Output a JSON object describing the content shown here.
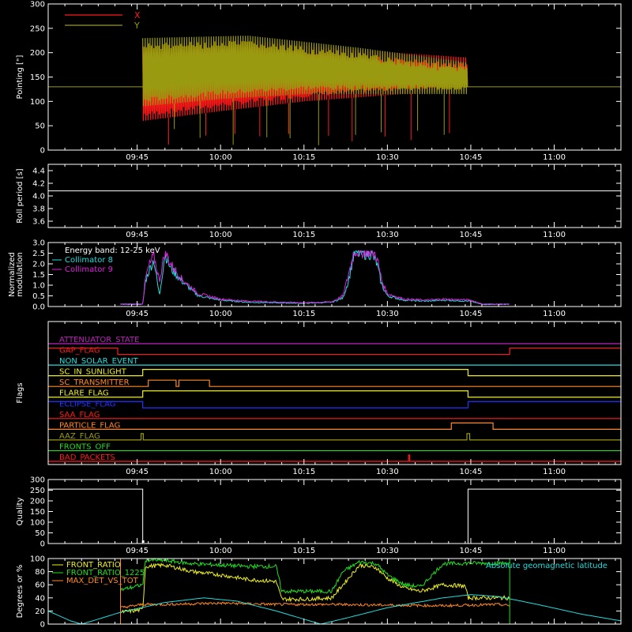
{
  "colors": {
    "background": "#000000",
    "axes": "#ffffff",
    "red": "#ff1a1a",
    "olive": "#9a9a10",
    "cyan": "#22dddd",
    "magenta": "#dd22dd",
    "yellow": "#eeee22",
    "green": "#22dd22",
    "orange": "#ff8822",
    "blue": "#2233ff",
    "purple": "#bb22bb"
  },
  "time_axis": {
    "ticks": [
      "09:45",
      "10:00",
      "10:15",
      "10:30",
      "10:45",
      "11:00"
    ],
    "tick_minutes": [
      585,
      600,
      615,
      630,
      645,
      660
    ],
    "range_minutes": [
      569,
      672
    ]
  },
  "chart_data": [
    {
      "id": "pointing",
      "type": "line",
      "ylabel": "Pointing [\"]",
      "ylim": [
        0,
        300
      ],
      "yticks": [
        0,
        50,
        100,
        150,
        200,
        250,
        300
      ],
      "legend": [
        "X",
        "Y"
      ],
      "series": [
        {
          "name": "X",
          "color": "red",
          "t_start": 586,
          "t_end": 644.5,
          "upper": [
            [
              586,
              215
            ],
            [
              605,
              225
            ],
            [
              625,
              205
            ],
            [
              644.5,
              190
            ]
          ],
          "lower": [
            [
              586,
              60
            ],
            [
              600,
              80
            ],
            [
              615,
              100
            ],
            [
              644.5,
              125
            ]
          ]
        },
        {
          "name": "Y",
          "color": "olive",
          "t_start": 586,
          "t_end": 644.5,
          "upper": [
            [
              586,
              230
            ],
            [
              605,
              235
            ],
            [
              625,
              210
            ],
            [
              644.5,
              180
            ]
          ],
          "lower": [
            [
              586,
              90
            ],
            [
              600,
              105
            ],
            [
              615,
              115
            ],
            [
              644.5,
              115
            ]
          ]
        }
      ],
      "reference_level": 130
    },
    {
      "id": "roll_period",
      "type": "line",
      "ylabel": "Roll period [s]",
      "ylim": [
        3.5,
        4.5
      ],
      "yticks": [
        3.6,
        3.8,
        4.0,
        4.2,
        4.4
      ],
      "series": [
        {
          "name": "",
          "color": "axes",
          "constant": 4.08
        }
      ]
    },
    {
      "id": "modulation",
      "type": "line",
      "ylabel": "Normalized modulation",
      "ylim": [
        0,
        3.0
      ],
      "yticks": [
        0.0,
        0.5,
        1.0,
        1.5,
        2.0,
        2.5,
        3.0
      ],
      "legend_title": "Energy band: 12-25 keV",
      "legend": [
        "Collimator 8",
        "Collimator 9"
      ],
      "series": [
        {
          "name": "Collimator 8",
          "color": "cyan",
          "points": [
            [
              582,
              0.1
            ],
            [
              586,
              0.1
            ],
            [
              586.5,
              1.2
            ],
            [
              587,
              1.6
            ],
            [
              588,
              2.2
            ],
            [
              589,
              0.5
            ],
            [
              590,
              2.5
            ],
            [
              591,
              1.8
            ],
            [
              593,
              1.2
            ],
            [
              596,
              0.5
            ],
            [
              600,
              0.3
            ],
            [
              605,
              0.2
            ],
            [
              615,
              0.15
            ],
            [
              620,
              0.2
            ],
            [
              622,
              0.4
            ],
            [
              623,
              1.2
            ],
            [
              624,
              2.5
            ],
            [
              627,
              2.5
            ],
            [
              628,
              2.1
            ],
            [
              629,
              1.0
            ],
            [
              630,
              0.5
            ],
            [
              633,
              0.3
            ],
            [
              637,
              0.25
            ],
            [
              640,
              0.3
            ],
            [
              645,
              0.25
            ],
            [
              647,
              0.1
            ],
            [
              652,
              0.1
            ]
          ]
        },
        {
          "name": "Collimator 9",
          "color": "magenta",
          "points": [
            [
              582,
              0.12
            ],
            [
              586,
              0.12
            ],
            [
              586.5,
              1.3
            ],
            [
              587,
              1.8
            ],
            [
              588,
              2.4
            ],
            [
              589,
              1.2
            ],
            [
              590,
              2.6
            ],
            [
              591,
              2.0
            ],
            [
              593,
              1.3
            ],
            [
              596,
              0.6
            ],
            [
              600,
              0.35
            ],
            [
              605,
              0.25
            ],
            [
              615,
              0.18
            ],
            [
              620,
              0.22
            ],
            [
              622,
              0.5
            ],
            [
              623,
              1.5
            ],
            [
              624,
              2.6
            ],
            [
              627,
              2.6
            ],
            [
              628,
              2.4
            ],
            [
              629,
              1.2
            ],
            [
              630,
              0.6
            ],
            [
              633,
              0.35
            ],
            [
              637,
              0.3
            ],
            [
              640,
              0.35
            ],
            [
              645,
              0.3
            ],
            [
              647,
              0.12
            ],
            [
              652,
              0.12
            ]
          ]
        }
      ]
    },
    {
      "id": "flags",
      "type": "line",
      "ylabel": "Flags",
      "series": [
        {
          "name": "ATTENUATOR_STATE",
          "color": "purple",
          "steps": [
            [
              569,
              0
            ],
            [
              672,
              0
            ]
          ]
        },
        {
          "name": "GAP_FLAG",
          "color": "red",
          "steps": [
            [
              569,
              1
            ],
            [
              581.5,
              0
            ],
            [
              652,
              1
            ],
            [
              672,
              1
            ]
          ]
        },
        {
          "name": "NON_SOLAR_EVENT",
          "color": "cyan",
          "steps": [
            [
              569,
              0
            ],
            [
              672,
              0
            ]
          ]
        },
        {
          "name": "SC_IN_SUNLIGHT",
          "color": "yellow",
          "steps": [
            [
              569,
              0
            ],
            [
              586,
              1
            ],
            [
              644.5,
              0
            ],
            [
              672,
              0
            ]
          ]
        },
        {
          "name": "SC_TRANSMITTER",
          "color": "orange",
          "steps": [
            [
              569,
              0
            ],
            [
              587,
              1
            ],
            [
              592,
              0
            ],
            [
              592.5,
              1
            ],
            [
              598,
              0
            ],
            [
              672,
              0
            ]
          ]
        },
        {
          "name": "FLARE_FLAG",
          "color": "yellow",
          "steps": [
            [
              569,
              0
            ],
            [
              586,
              1
            ],
            [
              644.5,
              0
            ],
            [
              672,
              0
            ]
          ]
        },
        {
          "name": "ECLIPSE_FLAG",
          "color": "blue",
          "steps": [
            [
              569,
              1
            ],
            [
              586,
              0
            ],
            [
              644.5,
              1
            ],
            [
              672,
              1
            ]
          ]
        },
        {
          "name": "SAA_FLAG",
          "color": "red",
          "steps": [
            [
              569,
              0
            ],
            [
              672,
              0
            ]
          ]
        },
        {
          "name": "PARTICLE_FLAG",
          "color": "orange",
          "steps": [
            [
              569,
              0
            ],
            [
              641.5,
              1
            ],
            [
              649,
              0
            ],
            [
              672,
              0
            ]
          ]
        },
        {
          "name": "AAZ_FLAG",
          "color": "olive",
          "steps": [
            [
              569,
              0
            ],
            [
              585.7,
              1
            ],
            [
              586.1,
              0
            ],
            [
              644.3,
              1
            ],
            [
              644.8,
              0
            ],
            [
              672,
              0
            ]
          ]
        },
        {
          "name": "FRONTS_OFF",
          "color": "green",
          "steps": [
            [
              569,
              0
            ],
            [
              672,
              0
            ]
          ]
        },
        {
          "name": "BAD_PACKETS",
          "color": "red",
          "steps": [
            [
              569,
              0
            ],
            [
              633.8,
              1
            ],
            [
              634.0,
              0
            ],
            [
              672,
              0
            ]
          ]
        }
      ]
    },
    {
      "id": "quality",
      "type": "line",
      "ylabel": "Quality",
      "ylim": [
        0,
        300
      ],
      "yticks": [
        0,
        50,
        100,
        150,
        200,
        250,
        300
      ],
      "series": [
        {
          "name": "",
          "color": "axes",
          "steps": [
            [
              569,
              255
            ],
            [
              586,
              0
            ],
            [
              644.5,
              255
            ],
            [
              672,
              255
            ]
          ]
        }
      ]
    },
    {
      "id": "ratios",
      "type": "line",
      "ylabel": "Degrees or %",
      "ylim": [
        0,
        100
      ],
      "yticks": [
        0,
        20,
        40,
        60,
        80,
        100
      ],
      "legend": [
        "FRONT_RATIO",
        "FRONT_RATIO_1225",
        "MAX_DET_VS_TOT"
      ],
      "annotation": "Absolute geomagnetic latitude",
      "series": [
        {
          "name": "FRONT_RATIO",
          "color": "yellow",
          "points": [
            [
              582,
              18
            ],
            [
              586,
              22
            ],
            [
              586.5,
              88
            ],
            [
              590,
              90
            ],
            [
              595,
              80
            ],
            [
              600,
              75
            ],
            [
              605,
              68
            ],
            [
              610,
              65
            ],
            [
              611,
              38
            ],
            [
              615,
              38
            ],
            [
              620,
              40
            ],
            [
              622,
              60
            ],
            [
              625,
              90
            ],
            [
              628,
              86
            ],
            [
              630,
              70
            ],
            [
              633,
              55
            ],
            [
              636,
              50
            ],
            [
              640,
              60
            ],
            [
              644,
              58
            ],
            [
              644.5,
              40
            ],
            [
              652,
              40
            ]
          ]
        },
        {
          "name": "FRONT_RATIO_1225",
          "color": "green",
          "points": [
            [
              582,
              52
            ],
            [
              586,
              60
            ],
            [
              586.5,
              98
            ],
            [
              590,
              97
            ],
            [
              595,
              92
            ],
            [
              600,
              90
            ],
            [
              605,
              88
            ],
            [
              610,
              88
            ],
            [
              611,
              50
            ],
            [
              615,
              50
            ],
            [
              620,
              50
            ],
            [
              622,
              80
            ],
            [
              625,
              95
            ],
            [
              628,
              92
            ],
            [
              630,
              75
            ],
            [
              633,
              60
            ],
            [
              636,
              57
            ],
            [
              640,
              92
            ],
            [
              645,
              93
            ],
            [
              652,
              93
            ]
          ]
        },
        {
          "name": "MAX_DET_VS_TOT",
          "color": "orange",
          "points": [
            [
              582,
              25
            ],
            [
              586,
              30
            ],
            [
              590,
              30
            ],
            [
              600,
              32
            ],
            [
              610,
              30
            ],
            [
              620,
              30
            ],
            [
              630,
              29
            ],
            [
              640,
              28
            ],
            [
              650,
              30
            ],
            [
              652,
              28
            ]
          ]
        },
        {
          "name": "Absolute geomagnetic latitude",
          "color": "cyan",
          "points": [
            [
              569,
              20
            ],
            [
              573,
              5
            ],
            [
              575,
              0
            ],
            [
              577,
              5
            ],
            [
              582,
              18
            ],
            [
              590,
              33
            ],
            [
              597,
              40
            ],
            [
              603,
              35
            ],
            [
              610,
              20
            ],
            [
              618,
              0
            ],
            [
              623,
              10
            ],
            [
              630,
              25
            ],
            [
              640,
              40
            ],
            [
              645,
              45
            ],
            [
              650,
              42
            ],
            [
              657,
              30
            ],
            [
              665,
              15
            ],
            [
              672,
              5
            ]
          ]
        }
      ]
    }
  ]
}
